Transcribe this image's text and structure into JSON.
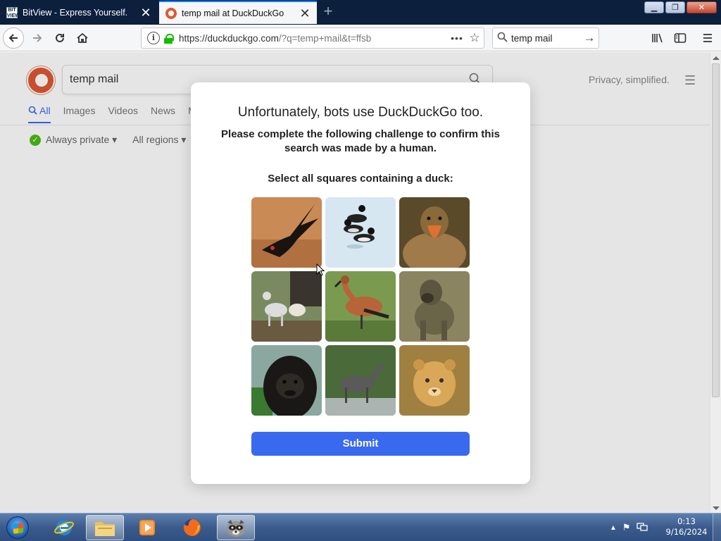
{
  "browser": {
    "tabs": [
      {
        "title": "BitView - Express Yourself.",
        "favicon": "bitview-icon",
        "active": false
      },
      {
        "title": "temp mail at DuckDuckGo",
        "favicon": "duckduckgo-icon",
        "active": true
      }
    ],
    "url": {
      "domain": "https://duckduckgo.com",
      "path": "/?q=temp+mail&t=ffsb"
    },
    "search_box": "temp mail"
  },
  "ddg": {
    "query": "temp mail",
    "tagline": "Privacy, simplified.",
    "tabs": [
      "All",
      "Images",
      "Videos",
      "News",
      "M"
    ],
    "filters": {
      "private": "Always private ▾",
      "regions": "All regions ▾"
    }
  },
  "challenge": {
    "title": "Unfortunately, bots use DuckDuckGo too.",
    "subtitle": "Please complete the following challenge to confirm this search was made by a human.",
    "prompt": "Select all squares containing a duck:",
    "tiles": [
      {
        "name": "flying-bird"
      },
      {
        "name": "floating-ducks"
      },
      {
        "name": "duck-closeup"
      },
      {
        "name": "dogs-on-log"
      },
      {
        "name": "whistling-duck"
      },
      {
        "name": "baboon"
      },
      {
        "name": "gorilla"
      },
      {
        "name": "antelope"
      },
      {
        "name": "lion-cub"
      }
    ],
    "submit": "Submit"
  },
  "taskbar": {
    "items": [
      "internet-explorer-icon",
      "file-explorer-icon",
      "media-player-icon",
      "firefox-icon",
      "raccoon-app-icon"
    ],
    "clock_time": "0:13",
    "clock_date": "9/16/2024"
  },
  "colors": {
    "accent": "#3969ef",
    "ddg_orange": "#de5833",
    "tab_bar": "#0c1f3c"
  }
}
